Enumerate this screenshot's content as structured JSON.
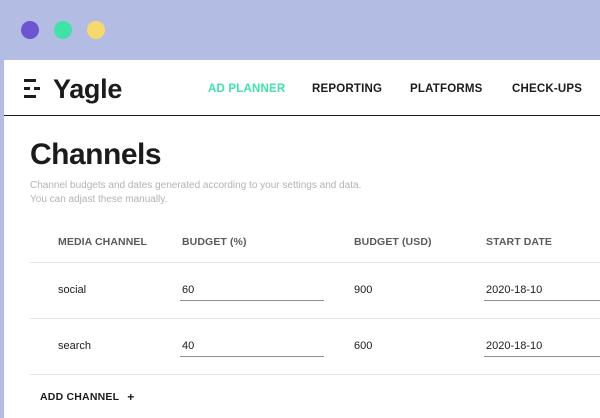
{
  "colors": {
    "background": "#b3bde3",
    "dot_purple": "#6e55d0",
    "dot_green": "#3fe3a8",
    "dot_yellow": "#f7d96b",
    "accent": "#3fe3a8",
    "text": "#1b1b1b"
  },
  "brand": {
    "name": "Yagle",
    "icon": "logo-icon"
  },
  "nav": {
    "items": [
      {
        "label": "AD PLANNER",
        "active": true
      },
      {
        "label": "REPORTING",
        "active": false
      },
      {
        "label": "PLATFORMS",
        "active": false
      },
      {
        "label": "CHECK-UPS",
        "active": false
      }
    ]
  },
  "page": {
    "title": "Channels",
    "subtitle_line1": "Channel budgets and dates generated according to your settings and data.",
    "subtitle_line2": "You can adjast these manually."
  },
  "table": {
    "columns": [
      "MEDIA CHANNEL",
      "BUDGET (%)",
      "BUDGET (USD)",
      "START DATE"
    ],
    "rows": [
      {
        "channel": "social",
        "budget_pct": "60",
        "budget_usd": "900",
        "start_date": "2020-18-10"
      },
      {
        "channel": "search",
        "budget_pct": "40",
        "budget_usd": "600",
        "start_date": "2020-18-10"
      }
    ]
  },
  "actions": {
    "add_channel": "ADD CHANNEL",
    "add_icon": "plus-icon",
    "plus_glyph": "+"
  }
}
